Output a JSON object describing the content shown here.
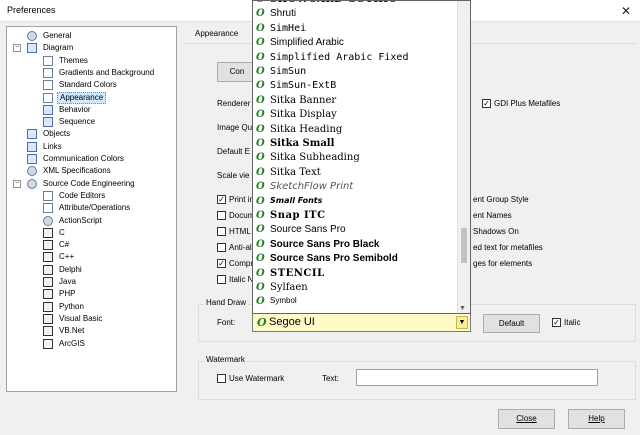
{
  "window": {
    "title": "Preferences",
    "close_glyph": "✕"
  },
  "tree": {
    "items": [
      {
        "label": "General",
        "icon": "general-icon",
        "level": 1
      },
      {
        "label": "Diagram",
        "icon": "diagram-icon",
        "level": 1,
        "expander": "−"
      },
      {
        "label": "Themes",
        "icon": "page-icon",
        "level": 2
      },
      {
        "label": "Gradients and Background",
        "icon": "page-icon",
        "level": 2
      },
      {
        "label": "Standard Colors",
        "icon": "page-icon",
        "level": 2
      },
      {
        "label": "Appearance",
        "icon": "page-icon",
        "level": 2,
        "selected": true
      },
      {
        "label": "Behavior",
        "icon": "behavior-icon",
        "level": 2
      },
      {
        "label": "Sequence",
        "icon": "sequence-icon",
        "level": 2
      },
      {
        "label": "Objects",
        "icon": "objects-icon",
        "level": 1
      },
      {
        "label": "Links",
        "icon": "links-icon",
        "level": 1
      },
      {
        "label": "Communication Colors",
        "icon": "colors-icon",
        "level": 1
      },
      {
        "label": "XML Specifications",
        "icon": "gear-icon",
        "level": 1
      },
      {
        "label": "Source Code Engineering",
        "icon": "gear-icon",
        "level": 1,
        "expander": "−"
      },
      {
        "label": "Code Editors",
        "icon": "page-icon",
        "level": 2
      },
      {
        "label": "Attribute/Operations",
        "icon": "page-icon",
        "level": 2
      },
      {
        "label": "ActionScript",
        "icon": "gear-icon",
        "level": 2
      },
      {
        "label": "C",
        "icon": "c-icon",
        "level": 2
      },
      {
        "label": "C#",
        "icon": "csharp-icon",
        "level": 2
      },
      {
        "label": "C++",
        "icon": "cpp-icon",
        "level": 2
      },
      {
        "label": "Delphi",
        "icon": "delphi-icon",
        "level": 2
      },
      {
        "label": "Java",
        "icon": "java-icon",
        "level": 2
      },
      {
        "label": "PHP",
        "icon": "php-icon",
        "level": 2
      },
      {
        "label": "Python",
        "icon": "python-icon",
        "level": 2
      },
      {
        "label": "Visual Basic",
        "icon": "vb-icon",
        "level": 2
      },
      {
        "label": "VB.Net",
        "icon": "vbnet-icon",
        "level": 2
      },
      {
        "label": "ArcGIS",
        "icon": "arcgis-icon",
        "level": 2
      }
    ]
  },
  "panel": {
    "tab_label": "Appearance",
    "con_button": "Con",
    "renderer_label": "Renderer",
    "image_quality_label": "Image Qu",
    "default_label": "Default E",
    "scale_label": "Scale vie",
    "gdi_label": "GDI Plus Metafiles",
    "gdi_checked": true,
    "left_checks": [
      {
        "label": "Print in",
        "checked": true
      },
      {
        "label": "Docum",
        "checked": false
      },
      {
        "label": "HTML",
        "checked": false
      },
      {
        "label": "Anti-ali",
        "checked": false
      },
      {
        "label": "Compr",
        "checked": true
      },
      {
        "label": "Italic N",
        "checked": false
      }
    ],
    "right_labels": [
      "ent Group Style",
      "ent Names",
      "Shadows On",
      "ed text for metafiles",
      "ges for elements"
    ]
  },
  "hand_draw": {
    "group_title": "Hand Draw",
    "font_label": "Font:",
    "font_value": "Segoe UI",
    "default_button": "Default",
    "italic_label": "Italic",
    "italic_checked": true
  },
  "font_dropdown": {
    "items": [
      "SHOWCARD GOTHIC",
      "Shruti",
      "SimHei",
      "Simplified Arabic",
      "Simplified Arabic Fixed",
      "SimSun",
      "SimSun-ExtB",
      "Sitka Banner",
      "Sitka Display",
      "Sitka Heading",
      "Sitka Small",
      "Sitka Subheading",
      "Sitka Text",
      "SketchFlow Print",
      "Small Fonts",
      "Snap ITC",
      "Source Sans Pro",
      "Source Sans Pro Black",
      "Source Sans Pro Semibold",
      "STENCIL",
      "Sylfaen",
      "Symbol"
    ],
    "icon_glyph": "O"
  },
  "watermark": {
    "group_title": "Watermark",
    "use_label": "Use Watermark",
    "use_checked": false,
    "text_label": "Text:",
    "text_value": ""
  },
  "footer": {
    "close_label": "Close",
    "help_label": "Help"
  }
}
